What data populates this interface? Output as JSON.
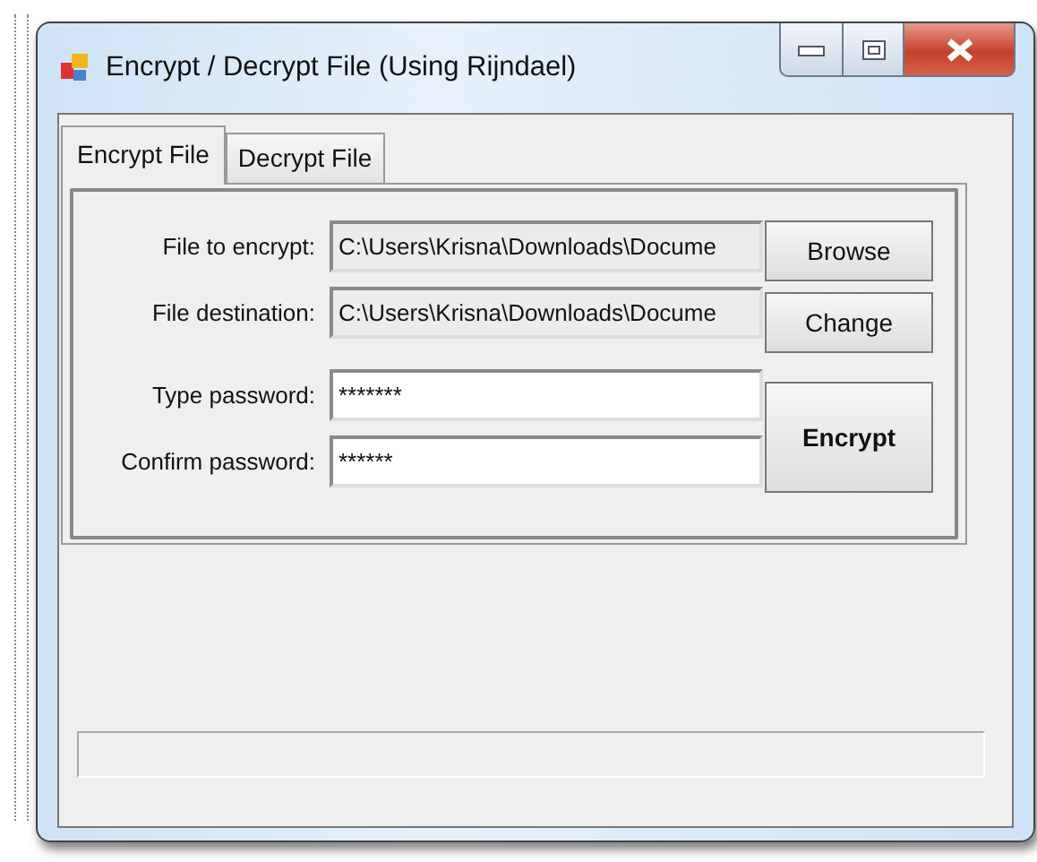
{
  "window": {
    "title": "Encrypt / Decrypt File (Using Rijndael)",
    "controls": [
      {
        "kind": "minimize"
      },
      {
        "kind": "maximize"
      },
      {
        "kind": "close"
      }
    ]
  },
  "tabs": [
    {
      "label": "Encrypt File",
      "selected": true
    },
    {
      "label": "Decrypt File",
      "selected": false
    }
  ],
  "fields": [
    {
      "label": "File to encrypt:",
      "value": "C:\\Users\\Krisna\\Downloads\\Docume",
      "readonly": true
    },
    {
      "label": "File destination:",
      "value": "C:\\Users\\Krisna\\Downloads\\Docume",
      "readonly": true
    },
    {
      "label": "Type password:",
      "value": "*******",
      "readonly": false
    },
    {
      "label": "Confirm password:",
      "value": "******",
      "readonly": false
    }
  ],
  "buttons": [
    {
      "label": "Browse",
      "kind": "small"
    },
    {
      "label": "Change",
      "kind": "small"
    },
    {
      "label": "Encrypt",
      "kind": "default"
    }
  ],
  "progress": {
    "level": 0
  }
}
